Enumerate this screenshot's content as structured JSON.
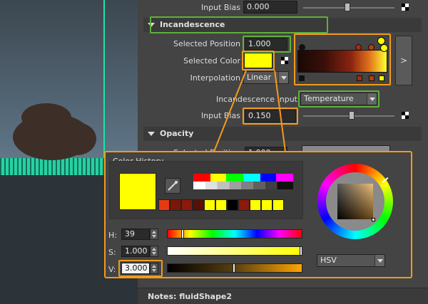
{
  "panel": {
    "top_input_bias": {
      "label": "Input Bias",
      "value": "0.000"
    },
    "incandescence": {
      "section_title": "Incandescence",
      "selected_position": {
        "label": "Selected Position",
        "value": "1.000"
      },
      "selected_color": {
        "label": "Selected Color",
        "hex": "#ffff00"
      },
      "interpolation": {
        "label": "Interpolation",
        "value": "Linear"
      },
      "input": {
        "label": "Incandescence Input",
        "value": "Temperature"
      },
      "input_bias": {
        "label": "Input Bias",
        "value": "0.150"
      },
      "ramp_expand": ">"
    },
    "opacity": {
      "section_title": "Opacity",
      "selected_position": {
        "label": "Selected Position",
        "value": "1.000"
      }
    },
    "notes": "Notes: fluidShape2"
  },
  "color_history": {
    "title": "Color History",
    "current_color": "#ffff00",
    "palette_top": [
      "#ff0000",
      "#ffff00",
      "#00ff00",
      "#00ffff",
      "#0000ff",
      "#ff00ff",
      "#ffffff",
      "#ffffff"
    ],
    "palette_gray": [
      "#ffffff",
      "#dddddd",
      "#bbbbbb",
      "#999999",
      "#777777",
      "#555555",
      "#333333",
      "#111111"
    ],
    "history": [
      "#e83a10",
      "#7a1708",
      "#8a1a0a",
      "#5a0f06",
      "#ffff00",
      "#ffff00",
      "#000000",
      "#8a1a0a",
      "#ffff00",
      "#ffff00",
      "#ffff00"
    ],
    "h": {
      "label": "H:",
      "value": "39"
    },
    "s": {
      "label": "S:",
      "value": "1.000"
    },
    "v": {
      "label": "V:",
      "value": "3.000"
    },
    "mode": "HSV"
  },
  "icons": {
    "eyedropper": "eyedropper-icon",
    "map": "checker-map-icon"
  }
}
